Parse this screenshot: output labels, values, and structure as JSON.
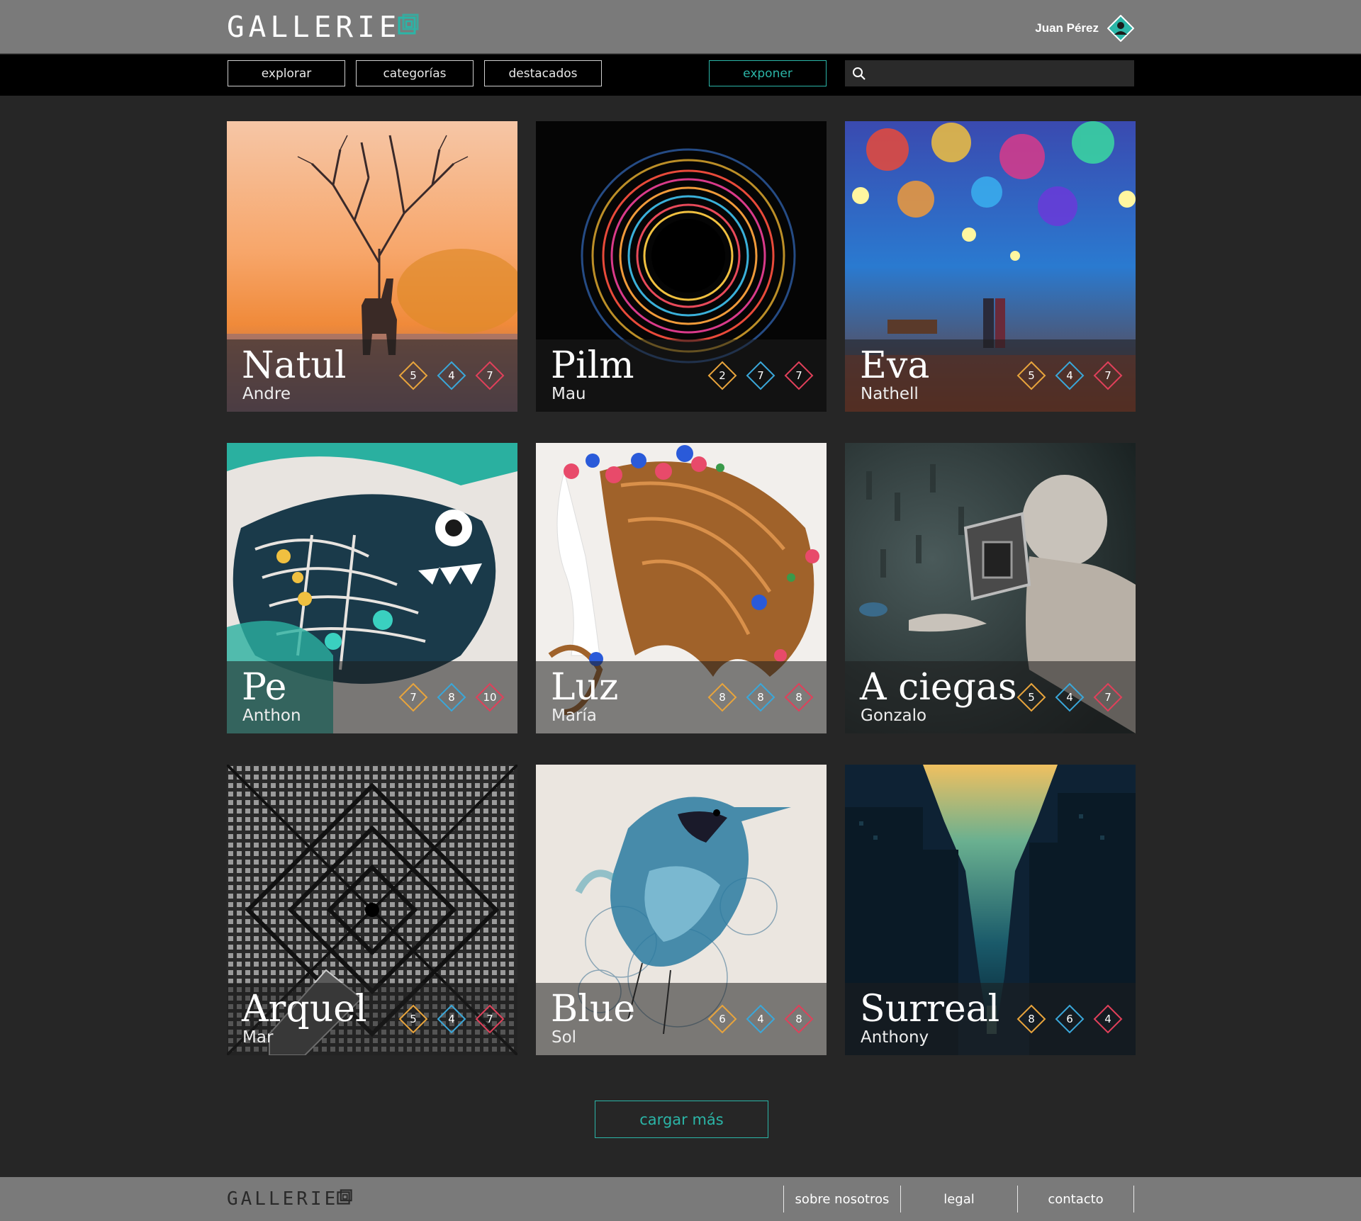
{
  "brand": {
    "logo": "GALLERIE"
  },
  "user": {
    "name": "Juan Pérez"
  },
  "nav": {
    "explore": "explorar",
    "categories": "categorías",
    "featured": "destacados",
    "exhibit": "exponer"
  },
  "search": {
    "placeholder": ""
  },
  "gallery": [
    {
      "title": "Natul",
      "author": "Andre",
      "ratings": [
        "5",
        "4",
        "7"
      ]
    },
    {
      "title": "Pilm",
      "author": "Mau",
      "ratings": [
        "2",
        "7",
        "7"
      ]
    },
    {
      "title": "Eva",
      "author": "Nathell",
      "ratings": [
        "5",
        "4",
        "7"
      ]
    },
    {
      "title": "Pe",
      "author": "Anthon",
      "ratings": [
        "7",
        "8",
        "10"
      ]
    },
    {
      "title": "Luz",
      "author": "María",
      "ratings": [
        "8",
        "8",
        "8"
      ]
    },
    {
      "title": "A ciegas",
      "author": "Gonzalo",
      "ratings": [
        "5",
        "4",
        "7"
      ]
    },
    {
      "title": "Arquel",
      "author": "Mar",
      "ratings": [
        "5",
        "4",
        "7"
      ]
    },
    {
      "title": "Blue",
      "author": "Sol",
      "ratings": [
        "6",
        "4",
        "8"
      ]
    },
    {
      "title": "Surreal",
      "author": "Anthony",
      "ratings": [
        "8",
        "6",
        "4"
      ]
    }
  ],
  "load_more": "cargar más",
  "footer": {
    "logo": "GALLERIE",
    "about": "sobre nosotros",
    "legal": "legal",
    "contact": "contacto"
  },
  "colors": {
    "accent": "#2bb5a7",
    "rating_1": "#e8a43c",
    "rating_2": "#3aa7d9",
    "rating_3": "#e0405a"
  }
}
